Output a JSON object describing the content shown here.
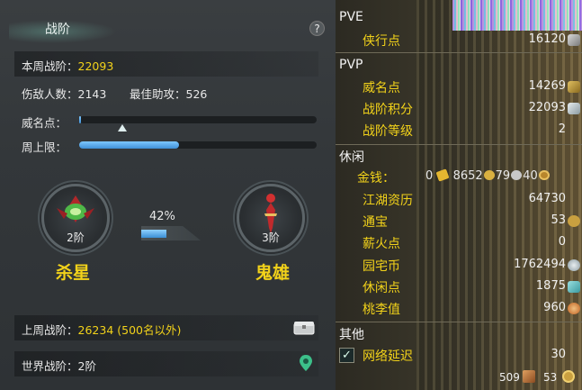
{
  "left": {
    "title": "战阶",
    "help_label": "?",
    "weekly": {
      "label": "本周战阶：",
      "value": "22093"
    },
    "stats": {
      "injured_label": "伤敌人数：",
      "injured_value": "2143",
      "assist_label": "最佳助攻：",
      "assist_value": "526"
    },
    "fame_label": "威名点：",
    "fame_progress": 0.12,
    "weekly_cap_label": "周上限：",
    "weekly_cap_progress": 0.42,
    "current_rank": {
      "level": "2阶",
      "name": "杀星"
    },
    "next_rank": {
      "level": "3阶",
      "name": "鬼雄"
    },
    "rank_progress_text": "42%",
    "rank_progress": 0.42,
    "last_week": {
      "label": "上周战阶：",
      "value": "26234 (500名以外)"
    },
    "world": {
      "label": "世界战阶：",
      "value": "2阶"
    }
  },
  "right": {
    "sections": {
      "pve": "PVE",
      "pvp": "PVP",
      "leisure": "休闲",
      "other": "其他"
    },
    "pve_items": [
      {
        "name": "侠行点",
        "value": "16120"
      }
    ],
    "pvp_items": [
      {
        "name": "威名点",
        "value": "14269"
      },
      {
        "name": "战阶积分",
        "value": "22093"
      },
      {
        "name": "战阶等级",
        "value": "2"
      }
    ],
    "money": {
      "name": "金钱：",
      "gold": "0",
      "silver": "8652",
      "copper": "79",
      "iron": "40"
    },
    "leisure_items": [
      {
        "name": "江湖资历",
        "value": "64730"
      },
      {
        "name": "通宝",
        "value": "53"
      },
      {
        "name": "薪火点",
        "value": "0"
      },
      {
        "name": "园宅币",
        "value": "1762494"
      },
      {
        "name": "休闲点",
        "value": "1875"
      },
      {
        "name": "桃李值",
        "value": "960"
      }
    ],
    "other_items": [
      {
        "name": "网络延迟",
        "value": "30"
      }
    ],
    "bottom": {
      "left_value": "509",
      "right_value": "53"
    }
  },
  "colors": {
    "accent_yellow": "#f2d21a",
    "bar_blue": "#3f8fd6"
  }
}
